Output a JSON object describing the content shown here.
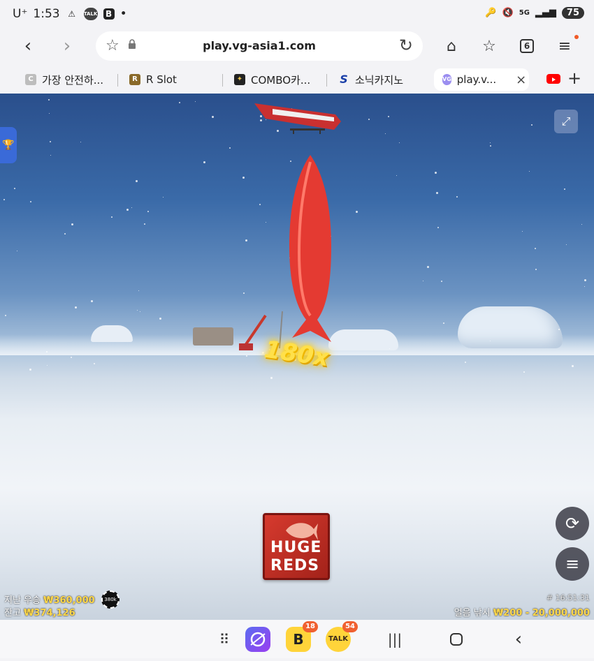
{
  "status": {
    "carrier": "U⁺",
    "time": "1:53",
    "network": "5G",
    "battery": "75"
  },
  "browser": {
    "url": "play.vg-asia1.com",
    "tab_count": "6",
    "tabs": [
      {
        "fav": "C",
        "label": "가장 안전하...",
        "color": "#bdbdbd"
      },
      {
        "fav": "R",
        "label": "R Slot",
        "color": "#8a6a2a"
      },
      {
        "fav": "✦",
        "label": "COMBO카...",
        "color": "#222222"
      },
      {
        "fav": "S",
        "label": "소닉카지노",
        "color": "#1a3fa8"
      },
      {
        "fav": "VG",
        "label": "play.v...",
        "color": "#9b8ef0"
      }
    ]
  },
  "game": {
    "multiplier": "180x",
    "logo_line1": "HUGE",
    "logo_line2": "REDS",
    "last_win_label": "지난 우승",
    "last_win_value": "₩360,000",
    "chip_label": "380k",
    "balance_label": "잔고",
    "balance_value": "₩374,126",
    "timestamp": "# 16:51:31",
    "game_name": "얼음 낚시",
    "bet_range": "₩200 - 20,000,000"
  },
  "bottom_nav": {
    "b_badge": "18",
    "talk_badge": "54",
    "talk_label": "TALK"
  }
}
